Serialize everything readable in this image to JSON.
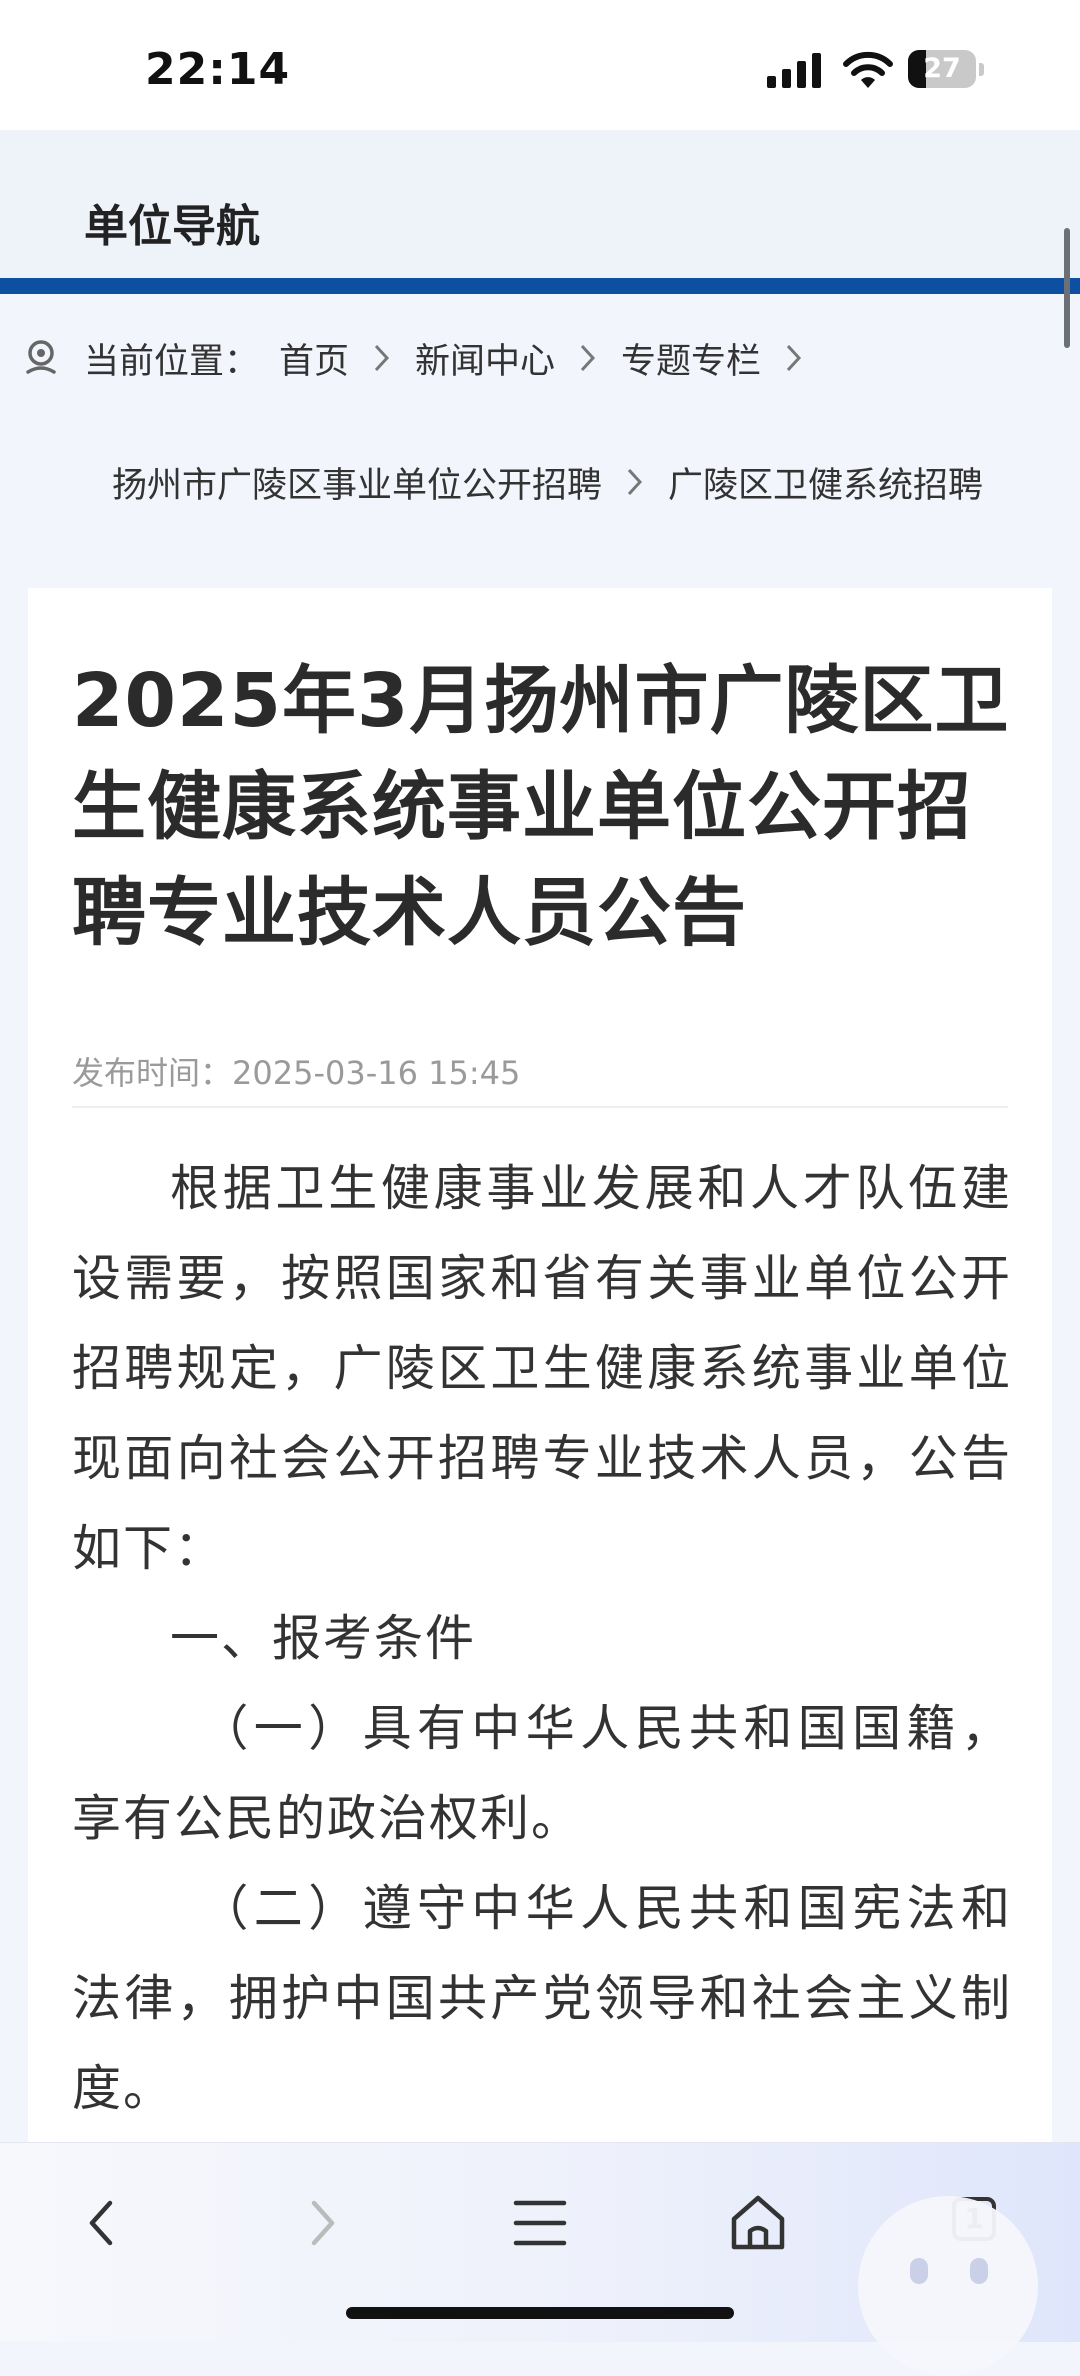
{
  "status_bar": {
    "time": "22:14",
    "battery_level": "27",
    "battery_fraction": 0.27,
    "icons": [
      "signal-icon",
      "wifi-icon",
      "battery-icon"
    ]
  },
  "header": {
    "title": "单位导航",
    "accent_color": "#0d4fa0"
  },
  "breadcrumb": {
    "prefix": "当前位置：",
    "items": [
      "首页",
      "新闻中心",
      "专题专栏",
      "扬州市广陵区事业单位公开招聘",
      "广陵区卫健系统招聘"
    ]
  },
  "article": {
    "title": "2025年3月扬州市广陵区卫生健康系统事业单位公开招聘专业技术人员公告",
    "published_label": "发布时间：",
    "published_time": "2025-03-16 15:45",
    "paragraphs": [
      "根据卫生健康事业发展和人才队伍建设需要，按照国家和省有关事业单位公开招聘规定，广陵区卫生健康系统事业单位现面向社会公开招聘专业技术人员，公告如下：",
      "一、报考条件",
      "（一）具有中华人民共和国国籍，享有公民的政治权利。",
      "（二）遵守中华人民共和国宪法和法律，拥护中国共产党领导和社会主义制度。"
    ]
  },
  "bottom_bar": {
    "tab_count": "1",
    "buttons": [
      "back",
      "forward",
      "menu",
      "home",
      "tabs"
    ]
  }
}
